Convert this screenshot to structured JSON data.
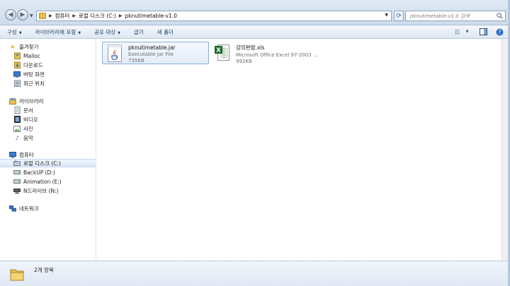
{
  "address_bar": {
    "breadcrumbs": [
      "컴퓨터",
      "로컬 디스크 (C:)",
      "pknutimetable-v1.0"
    ]
  },
  "search": {
    "placeholder": "pknutimetable-v1.0 검색"
  },
  "toolbar": {
    "organize": "구성",
    "include_in_library": "라이브러리에 포함",
    "share_with": "공유 대상",
    "burn": "굽기",
    "new_folder": "새 폴더"
  },
  "navigation": {
    "favorites": {
      "label": "즐겨찾기",
      "items": [
        "Malloc",
        "다운로드",
        "바탕 화면",
        "최근 위치"
      ]
    },
    "libraries": {
      "label": "라이브러리",
      "items": [
        "문서",
        "비디오",
        "사진",
        "음악"
      ]
    },
    "computer": {
      "label": "컴퓨터",
      "items": [
        "로컬 디스크 (C:)",
        "BackUP (D:)",
        "Animation (E:)",
        "N드라이브 (N:)"
      ],
      "selected_index": 0
    },
    "network": {
      "label": "네트워크"
    }
  },
  "files": [
    {
      "name": "pknutimetable.jar",
      "type": "Executable Jar File",
      "size": "735KB",
      "icon": "java-jar-icon",
      "selected": true
    },
    {
      "name": "강의편람.xls",
      "type": "Microsoft Office Excel 97-2003 ...",
      "size": "992KB",
      "icon": "excel-icon",
      "selected": false
    }
  ],
  "status": {
    "item_count": "2개 항목"
  },
  "colors": {
    "chrome": "#dfe9f5",
    "selection": "#dbe7f6",
    "folder": "#e7c04d"
  }
}
